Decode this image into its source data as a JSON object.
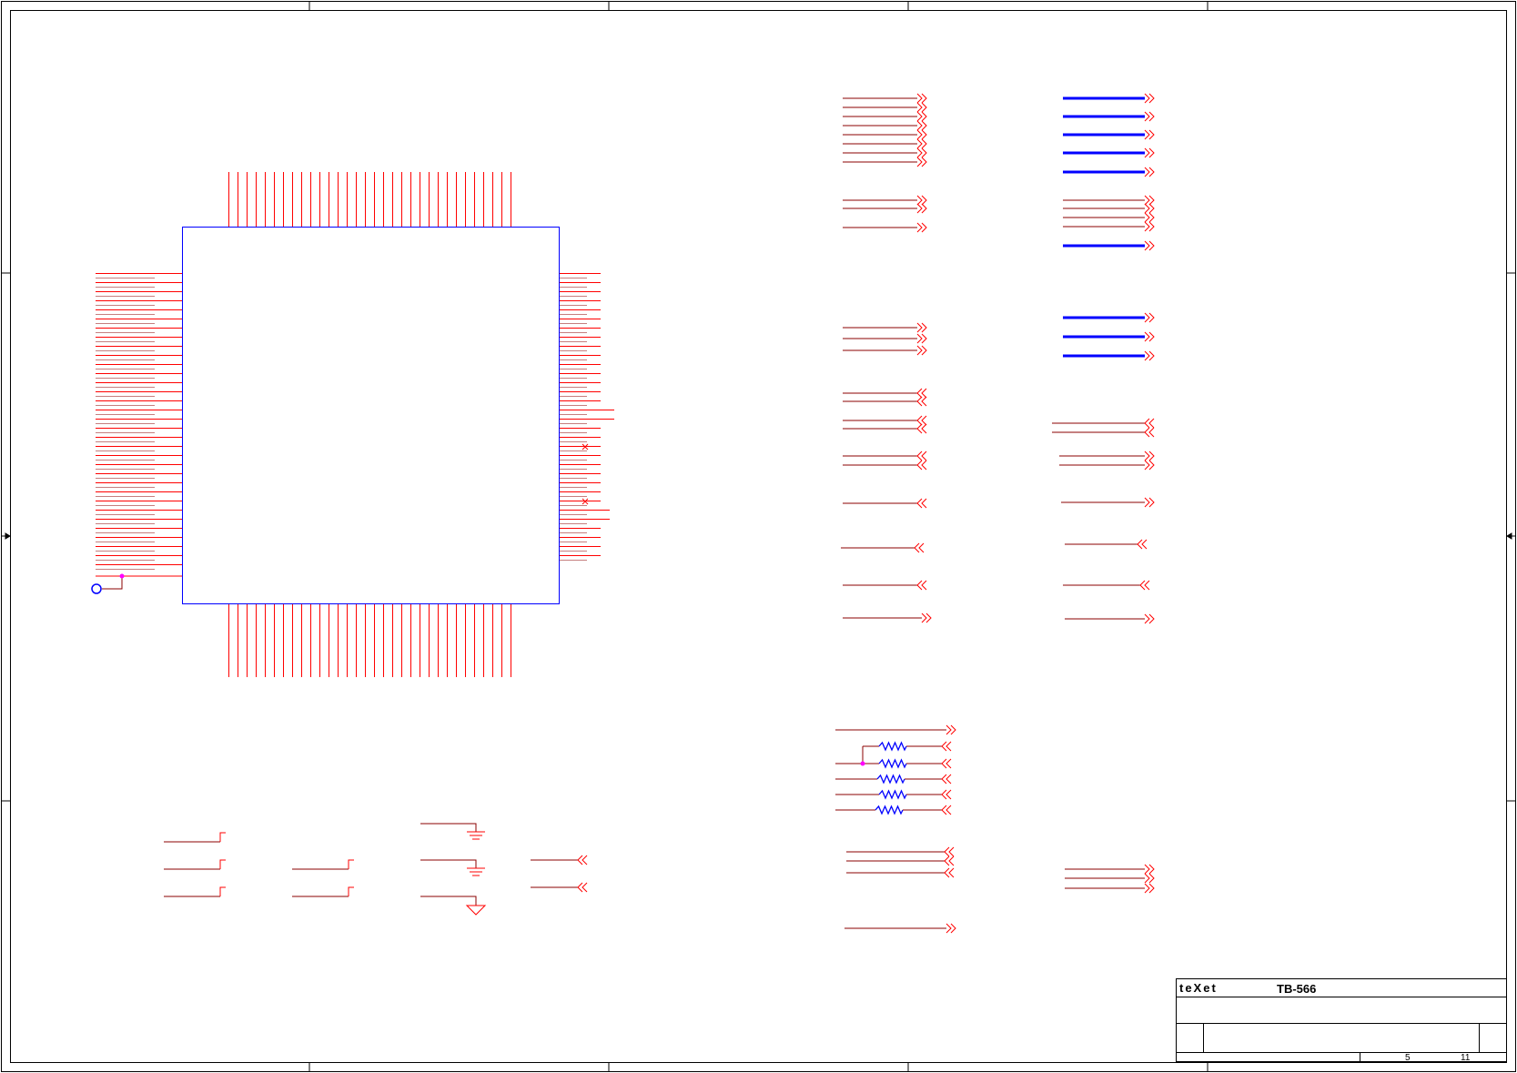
{
  "title_block": {
    "brand": "teXet",
    "model": "TB-566",
    "sheet": "5",
    "sheets_total": "11"
  },
  "colors": {
    "border": "#000000",
    "wire": "#8b0000",
    "pin": "#ff0000",
    "component": "#0000ff",
    "port": "#ff0000",
    "bus": "#0000ff",
    "junction": "#ff00ff",
    "brand_accent": "#ff6600"
  }
}
